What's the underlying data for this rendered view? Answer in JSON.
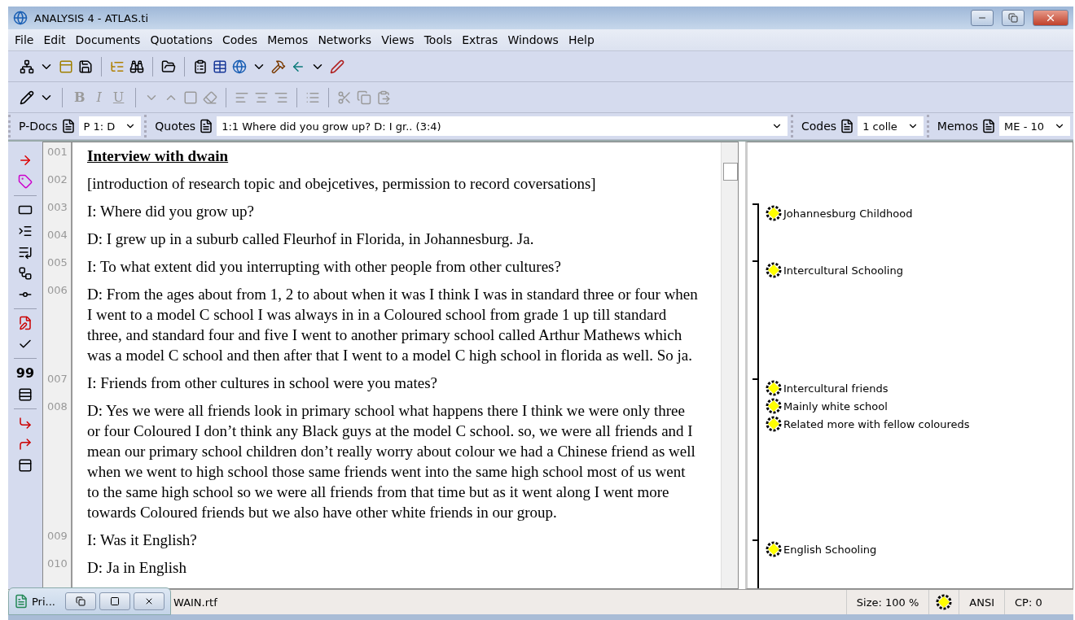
{
  "window": {
    "title": "ANALYSIS 4 - ATLAS.ti"
  },
  "menu": [
    "File",
    "Edit",
    "Documents",
    "Quotations",
    "Codes",
    "Memos",
    "Networks",
    "Views",
    "Tools",
    "Extras",
    "Windows",
    "Help"
  ],
  "format_buttons": [
    {
      "label": "B",
      "disabled": true
    },
    {
      "label": "I",
      "disabled": true
    },
    {
      "label": "U",
      "disabled": true
    }
  ],
  "selectors": [
    {
      "label": "P-Docs",
      "value": "P 1: D"
    },
    {
      "label": "Quotes",
      "value": "1:1 Where did you grow up? D: I gr.. (3:4)"
    },
    {
      "label": "Codes",
      "value": "1 colle"
    },
    {
      "label": "Memos",
      "value": "ME - 10"
    }
  ],
  "side_toolbar": {
    "quote_count": "99"
  },
  "document": {
    "paragraphs": [
      {
        "number": "001",
        "kind": "heading",
        "text": "Interview with dwain"
      },
      {
        "number": "002",
        "kind": "body",
        "text": "[introduction of research topic and obejcetives, permission to record coversations]"
      },
      {
        "number": "003",
        "kind": "body",
        "text": "I: Where did you grow up?"
      },
      {
        "number": "004",
        "kind": "body",
        "text": "D: I grew up in a suburb called Fleurhof in Florida, in Johannesburg. Ja."
      },
      {
        "number": "005",
        "kind": "body",
        "text": "I: To what extent did you interrupting with other people from other cultures?"
      },
      {
        "number": "006",
        "kind": "body",
        "text": "D: From the ages about from 1, 2 to about when it was I think I was in standard three or four when I went to a model C school I was always in in a Coloured school from grade 1 up till standard three, and standard four and five I went to another primary school called Arthur Mathews which was a model C school and then after that I went to a model C high school in florida as well. So ja."
      },
      {
        "number": "007",
        "kind": "body",
        "text": "I: Friends from other cultures in school were you mates?"
      },
      {
        "number": "008",
        "kind": "body",
        "text": "D: Yes we were all friends look in primary school what happens there I think we were only three or four Coloured I don’t think any Black guys at the model C school. so, we were all friends and I mean our primary school children don’t really worry about colour we had a Chinese friend as well when we went to high school those same friends went into the same high school most of us went to the same high school so we were all friends from that time but as it went along I went more towards Coloured friends but we also have other white friends in our group."
      },
      {
        "number": "009",
        "kind": "body",
        "text": "I: Was it English?"
      },
      {
        "number": "010",
        "kind": "body",
        "text": "D: Ja in English"
      }
    ]
  },
  "margin": {
    "groups": [
      {
        "codes": [
          "Johannesburg Childhood"
        ]
      },
      {
        "codes": [
          "Intercultural Schooling"
        ]
      },
      {
        "codes": [
          "Intercultural friends",
          "Mainly white school",
          "Related more with fellow coloureds"
        ]
      },
      {
        "codes": [
          "English Schooling"
        ]
      }
    ]
  },
  "status_bar": {
    "file": "WAIN.rtf",
    "size": "Size: 100 %",
    "encoding": "ANSI",
    "position": "CP: 0"
  },
  "minimized_window": {
    "title": "Pri..."
  }
}
